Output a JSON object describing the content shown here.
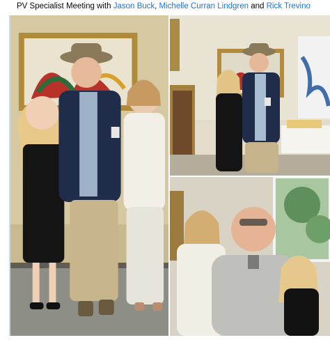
{
  "post": {
    "prefix": "PV Specialist Meeting with ",
    "tags": [
      "Jason Buck",
      "Michelle Curran Lindgren",
      "Rick Trevino"
    ],
    "sep_1": ", ",
    "sep_2": " and "
  },
  "photos": [
    {
      "name": "group photo of three people in gallery"
    },
    {
      "name": "two people posing by painting"
    },
    {
      "name": "selfie of three people by window"
    }
  ],
  "colors": {
    "link": "#1b74e4",
    "text": "#050505"
  }
}
